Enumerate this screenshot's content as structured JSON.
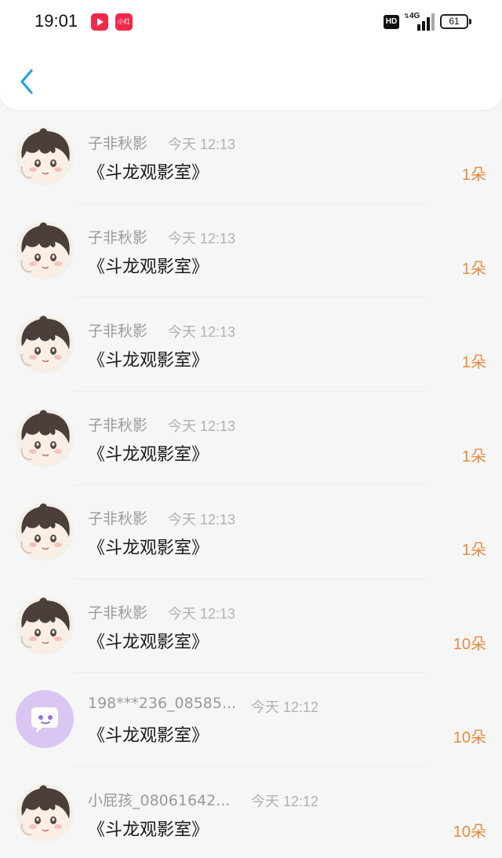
{
  "status_bar": {
    "time": "19:01",
    "apps": [
      "video-app-icon",
      "xiaohongshu-app-icon"
    ],
    "app_label_redbook": "小红书",
    "hd_label": "HD",
    "network_label": "4G",
    "battery": "61"
  },
  "nav": {
    "back_icon": "chevron-left-icon"
  },
  "colors": {
    "accent_back": "#2a9fe8",
    "gift_count": "#e98a3e",
    "name": "#9a9a9a",
    "time": "#b1b1b1"
  },
  "items": [
    {
      "avatar": "anime-boy-avatar",
      "name": "子非秋影",
      "time": "今天 12:13",
      "message": "《斗龙观影室》",
      "gift": "1朵"
    },
    {
      "avatar": "anime-boy-avatar",
      "name": "子非秋影",
      "time": "今天 12:13",
      "message": "《斗龙观影室》",
      "gift": "1朵"
    },
    {
      "avatar": "anime-boy-avatar",
      "name": "子非秋影",
      "time": "今天 12:13",
      "message": "《斗龙观影室》",
      "gift": "1朵"
    },
    {
      "avatar": "anime-boy-avatar",
      "name": "子非秋影",
      "time": "今天 12:13",
      "message": "《斗龙观影室》",
      "gift": "1朵"
    },
    {
      "avatar": "anime-boy-avatar",
      "name": "子非秋影",
      "time": "今天 12:13",
      "message": "《斗龙观影室》",
      "gift": "1朵"
    },
    {
      "avatar": "anime-boy-avatar",
      "name": "子非秋影",
      "time": "今天 12:13",
      "message": "《斗龙观影室》",
      "gift": "10朵"
    },
    {
      "avatar": "purple-chat-bubble-avatar",
      "name": "198***236_08585...",
      "time": "今天 12:12",
      "message": "《斗龙观影室》",
      "gift": "10朵"
    },
    {
      "avatar": "anime-boy-avatar",
      "name": "小屁孩_08061642...",
      "time": "今天 12:12",
      "message": "《斗龙观影室》",
      "gift": "10朵"
    }
  ]
}
